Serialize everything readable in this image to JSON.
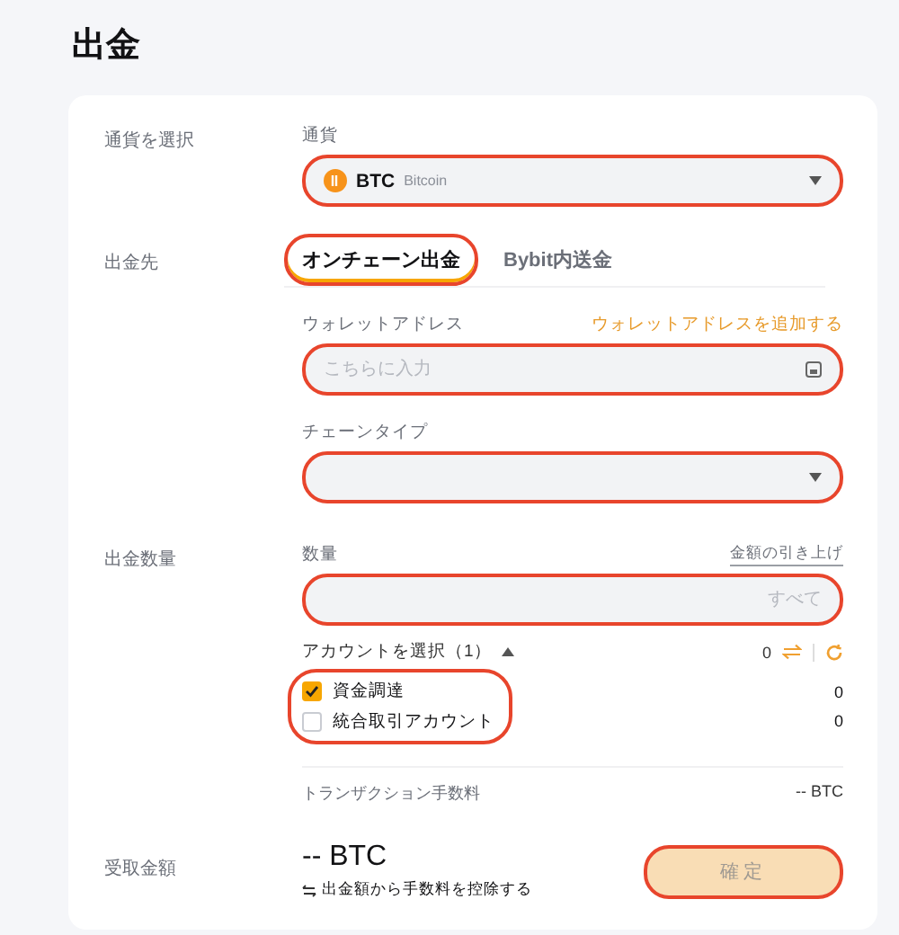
{
  "page": {
    "title": "出金"
  },
  "currency_section": {
    "label": "通貨を選択",
    "field_label": "通貨",
    "select": {
      "symbol": "BTC",
      "name": "Bitcoin",
      "highlighted": true
    }
  },
  "destination_section": {
    "label": "出金先",
    "tabs": [
      {
        "label": "オンチェーン出金",
        "selected": true,
        "highlighted": true
      },
      {
        "label": "Bybit内送金",
        "selected": false,
        "highlighted": false
      }
    ],
    "address": {
      "label": "ウォレットアドレス",
      "link": "ウォレットアドレスを追加する",
      "placeholder": "こちらに入力",
      "highlighted": true
    },
    "chain": {
      "label": "チェーンタイプ",
      "highlighted": true
    }
  },
  "amount_section": {
    "label": "出金数量",
    "field_label": "数量",
    "link": "金額の引き上げ",
    "placeholder": "すべて",
    "highlighted": true,
    "account_toggle": "アカウントを選択（1）",
    "expanded": true,
    "account_total": "0",
    "accounts_highlighted": true,
    "accounts": [
      {
        "name": "資金調達",
        "checked": true,
        "balance": "0"
      },
      {
        "name": "統合取引アカウント",
        "checked": false,
        "balance": "0"
      }
    ],
    "fee_label": "トランザクション手数料",
    "fee_value": "-- BTC"
  },
  "receive_section": {
    "label": "受取金額",
    "amount": "-- BTC",
    "note": "出金額から手数料を控除する",
    "button": {
      "label": "確定",
      "disabled": true,
      "highlighted": true
    }
  }
}
